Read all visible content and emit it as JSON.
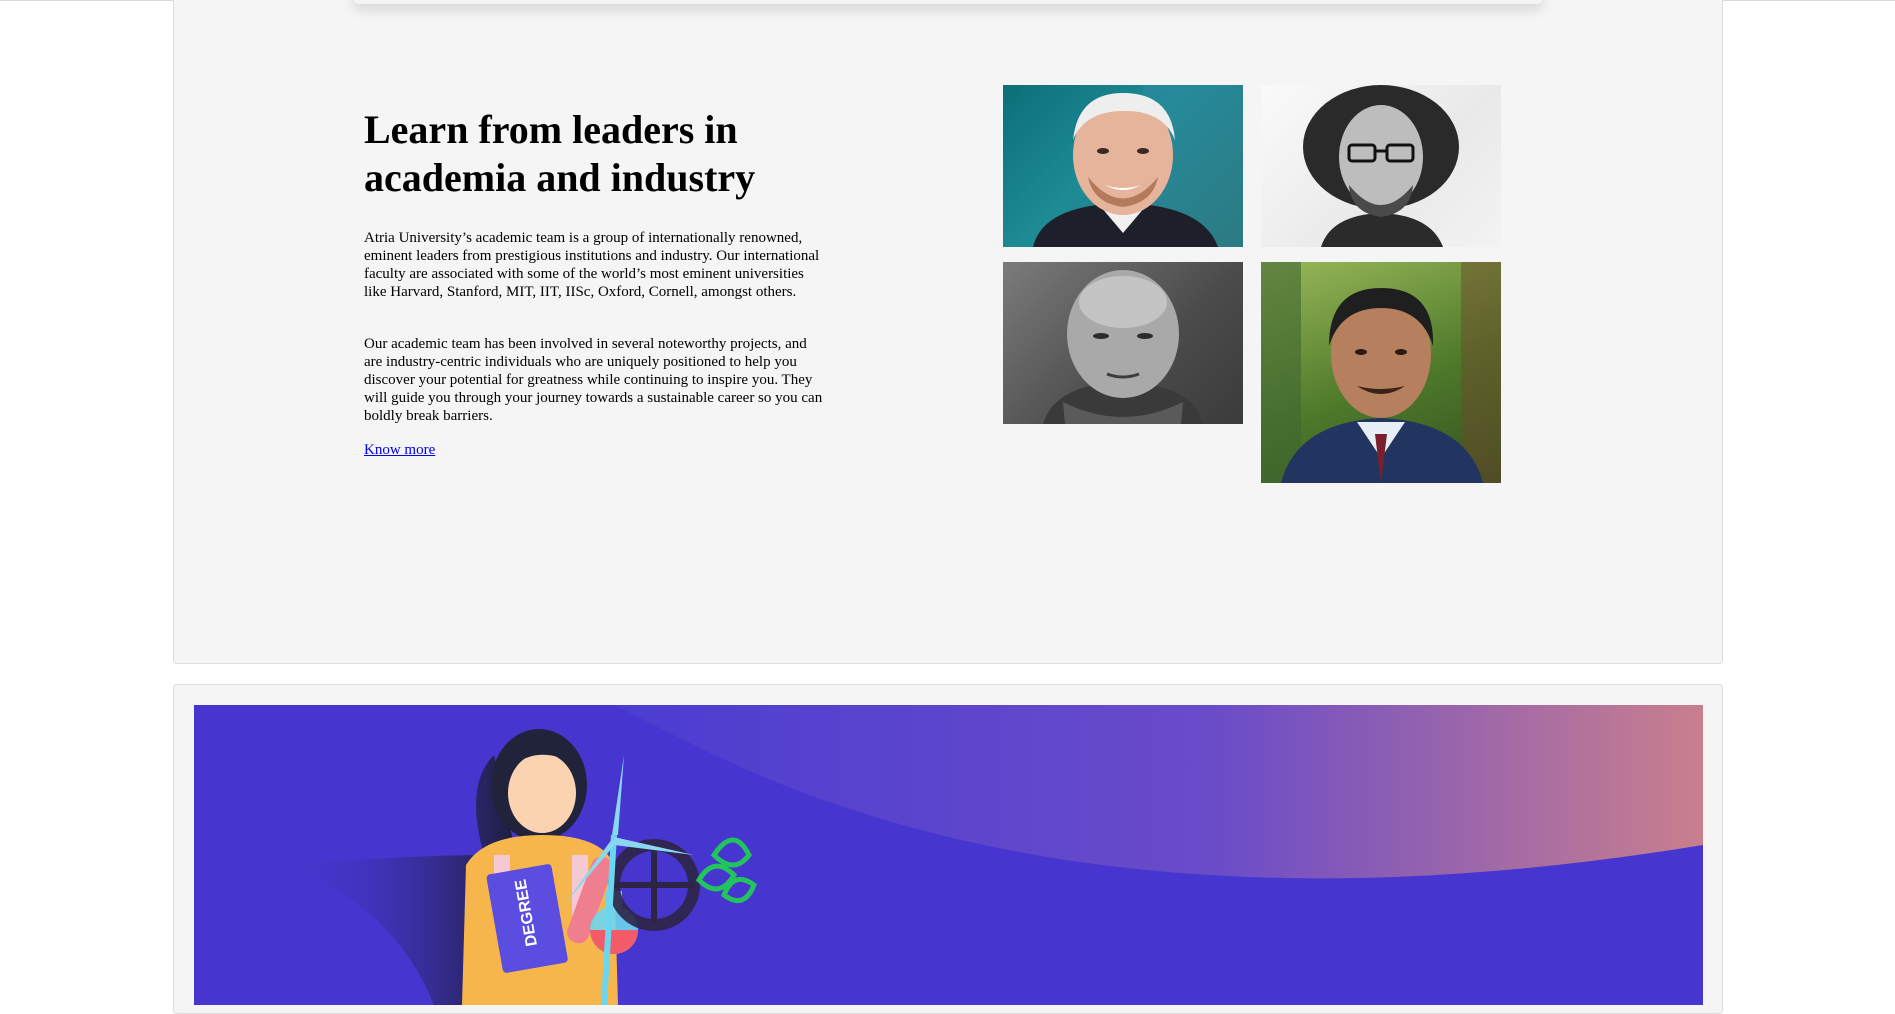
{
  "leaders_section": {
    "heading": "Learn from leaders in academia and industry",
    "paragraph_1": "Atria University’s academic team is a group of internationally renowned, eminent leaders from prestigious institutions and industry. Our international faculty are associated with some of the world’s most eminent universities like Harvard, Stanford, MIT, IIT, IISc, Oxford, Cornell, amongst others.",
    "paragraph_2": "Our academic team has been involved in several noteworthy projects, and are industry-centric individuals who are uniquely positioned to help you discover your potential for greatness while continuing to inspire you. They will guide you through your journey towards a sustainable career so you can boldly break barriers.",
    "link_label": "Know more",
    "faculty_photos": [
      {
        "icon": "faculty-portrait-teal-background"
      },
      {
        "icon": "faculty-portrait-grayscale-curly-hair"
      },
      {
        "icon": "faculty-portrait-grayscale-bald"
      },
      {
        "icon": "faculty-portrait-green-background"
      }
    ]
  },
  "banner": {
    "background_color": "#4636cf",
    "book_label": "DEGREE",
    "accent_colors": [
      "#f7d56b",
      "#f2a6c0",
      "#21c45d",
      "#6bd6f0"
    ]
  },
  "colors": {
    "page_background": "#ffffff",
    "card_background": "#f5f5f5",
    "link": "#0000ee"
  }
}
